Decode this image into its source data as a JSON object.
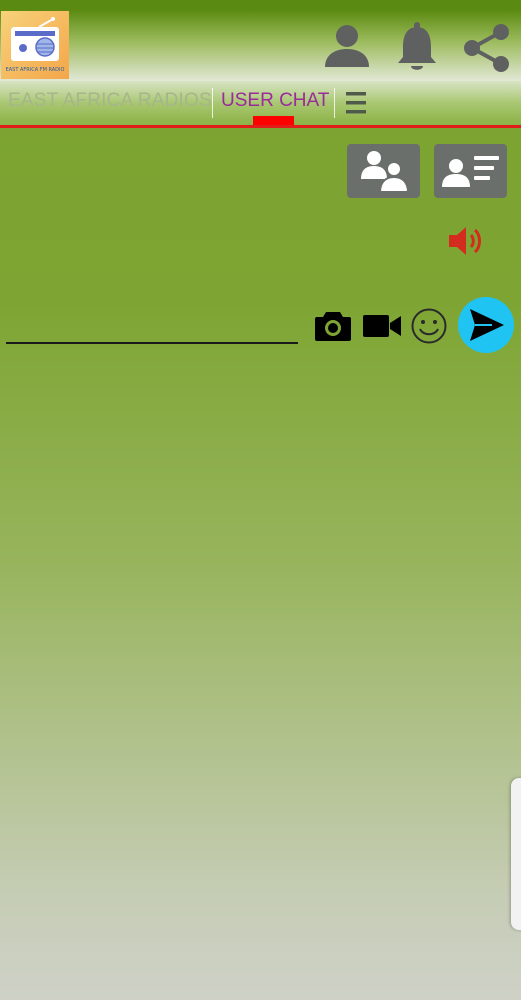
{
  "app": {
    "logo_caption": "EAST AFRICA FM RADIO",
    "header_icons": [
      "account-icon",
      "bell-icon",
      "share-icon"
    ]
  },
  "tabs": [
    {
      "label": "EAST AFRICA RADIOS",
      "selected": false
    },
    {
      "label": "USER CHAT",
      "selected": true
    }
  ],
  "menu_icon": "menu-icon",
  "chat": {
    "actions": [
      "users-group-icon",
      "user-list-icon"
    ],
    "sound": "speaker-icon",
    "input": {
      "value": "",
      "placeholder": ""
    },
    "tools": [
      "camera-icon",
      "video-icon",
      "emoji-icon"
    ],
    "send": "send-icon"
  },
  "colors": {
    "tab_selected": "#9b2a9b",
    "tab_unselected": "#a6b58a",
    "indicator": "#ff0000",
    "speaker": "#d32b1e",
    "send_button": "#1fc4f2",
    "action_button": "#6b6f6b"
  }
}
